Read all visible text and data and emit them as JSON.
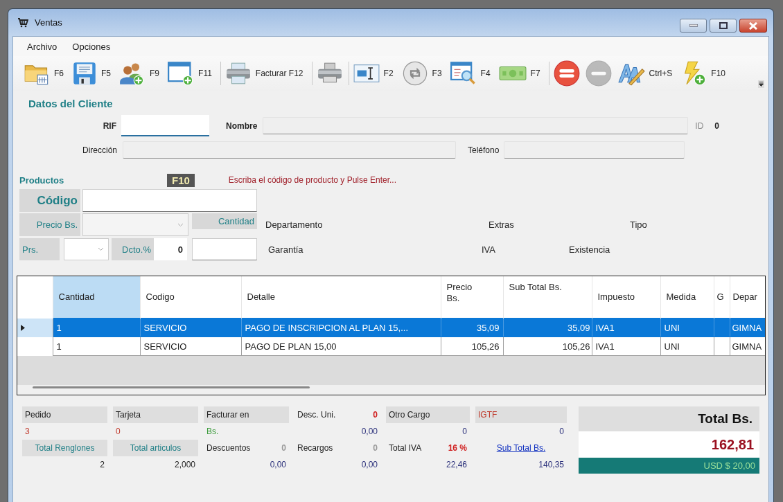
{
  "window": {
    "title": "Ventas"
  },
  "menu": [
    {
      "label": "Archivo"
    },
    {
      "label": "Opciones"
    }
  ],
  "toolbar": [
    {
      "kind": "button",
      "label": "F6",
      "disabled": false
    },
    {
      "kind": "button",
      "label": "F5",
      "disabled": false
    },
    {
      "kind": "button",
      "label": "F9",
      "disabled": false
    },
    {
      "kind": "button",
      "label": "F11",
      "disabled": false
    },
    {
      "kind": "separator"
    },
    {
      "kind": "button",
      "label": "Facturar F12",
      "disabled": false
    },
    {
      "kind": "separator"
    },
    {
      "kind": "button",
      "disabled": false
    },
    {
      "kind": "separator"
    },
    {
      "kind": "button",
      "label": "F2",
      "disabled": false
    },
    {
      "kind": "button",
      "label": "F3",
      "disabled": false
    },
    {
      "kind": "button",
      "label": "F4",
      "disabled": false
    },
    {
      "kind": "button",
      "label": "F7",
      "disabled": false
    },
    {
      "kind": "separator"
    },
    {
      "kind": "button",
      "disabled": false
    },
    {
      "kind": "button",
      "disabled": true
    },
    {
      "kind": "button",
      "label": "Ctrl+S",
      "disabled": false
    },
    {
      "kind": "button",
      "label": "F10",
      "disabled": false
    }
  ],
  "client": {
    "title": "Datos del Cliente",
    "rif_label": "RIF",
    "nombre_label": "Nombre",
    "id_label": "ID",
    "id_value": "0",
    "direccion_label": "Dirección",
    "telefono_label": "Teléfono"
  },
  "products": {
    "title": "Productos",
    "shortcut": "F10",
    "hint": "Escriba el código de producto y Pulse Enter...",
    "codigo_label": "Código",
    "precio_label": "Precio Bs.",
    "cantidad_label": "Cantidad",
    "prs_label": "Prs.",
    "dcto_label": "Dcto.%",
    "dcto_value": "0",
    "info_row_1": [
      "Departamento",
      "Extras",
      "Tipo"
    ],
    "info_row_2": [
      "Garantía",
      "IVA",
      "Existencia"
    ]
  },
  "table": {
    "columns": [
      {
        "label": "Cantidad",
        "selected": true
      },
      {
        "label": "Codigo",
        "selected": false
      },
      {
        "label": "Detalle",
        "selected": false
      },
      {
        "label": "Precio Bs.",
        "selected": false
      },
      {
        "label": "Sub Total Bs.",
        "selected": false
      },
      {
        "label": "Impuesto",
        "selected": false
      },
      {
        "label": "Medida",
        "selected": false
      },
      {
        "label": "G",
        "selected": false
      },
      {
        "label": "Depar",
        "selected": false
      }
    ],
    "rows": [
      {
        "selected": true,
        "cells": [
          "1",
          "SERVICIO",
          "PAGO DE INSCRIPCION AL PLAN 15,...",
          "35,09",
          "35,09",
          "IVA1",
          "UNI",
          "",
          "GIMNA"
        ]
      },
      {
        "selected": false,
        "cells": [
          "1",
          "SERVICIO",
          "PAGO DE PLAN 15,00",
          "105,26",
          "105,26",
          "IVA1",
          "UNI",
          "",
          "GIMNA"
        ]
      }
    ]
  },
  "summary_top": [
    {
      "kind": "boxed",
      "label": "Pedido",
      "value": "3"
    },
    {
      "kind": "boxed",
      "label": "Tarjeta",
      "value": "0"
    },
    {
      "kind": "boxed",
      "label": "Facturar en",
      "value": "Bs."
    },
    {
      "kind": "inline",
      "label": "Desc. Uni.",
      "badge": "0",
      "value": "0,00"
    },
    {
      "kind": "boxed",
      "label": "Otro Cargo",
      "value": "0"
    },
    {
      "kind": "boxed",
      "label": "IGTF",
      "value": "0"
    }
  ],
  "summary_bottom": [
    {
      "kind": "boxed",
      "label": "Total Renglones",
      "value": "2"
    },
    {
      "kind": "boxed",
      "label": "Total articulos",
      "value": "2,000"
    },
    {
      "kind": "inline",
      "label": "Descuentos",
      "badge": "0",
      "value": "0,00"
    },
    {
      "kind": "inline",
      "label": "Recargos",
      "badge": "0",
      "value": "0,00"
    },
    {
      "kind": "inline",
      "label": "Total IVA",
      "badge": "16 %",
      "value": "22,46"
    },
    {
      "kind": "link",
      "label": "Sub Total Bs.",
      "value": "140,35"
    }
  ],
  "totals": {
    "title": "Total Bs.",
    "amount": "162,81",
    "usd": "USD $ 20,00"
  }
}
